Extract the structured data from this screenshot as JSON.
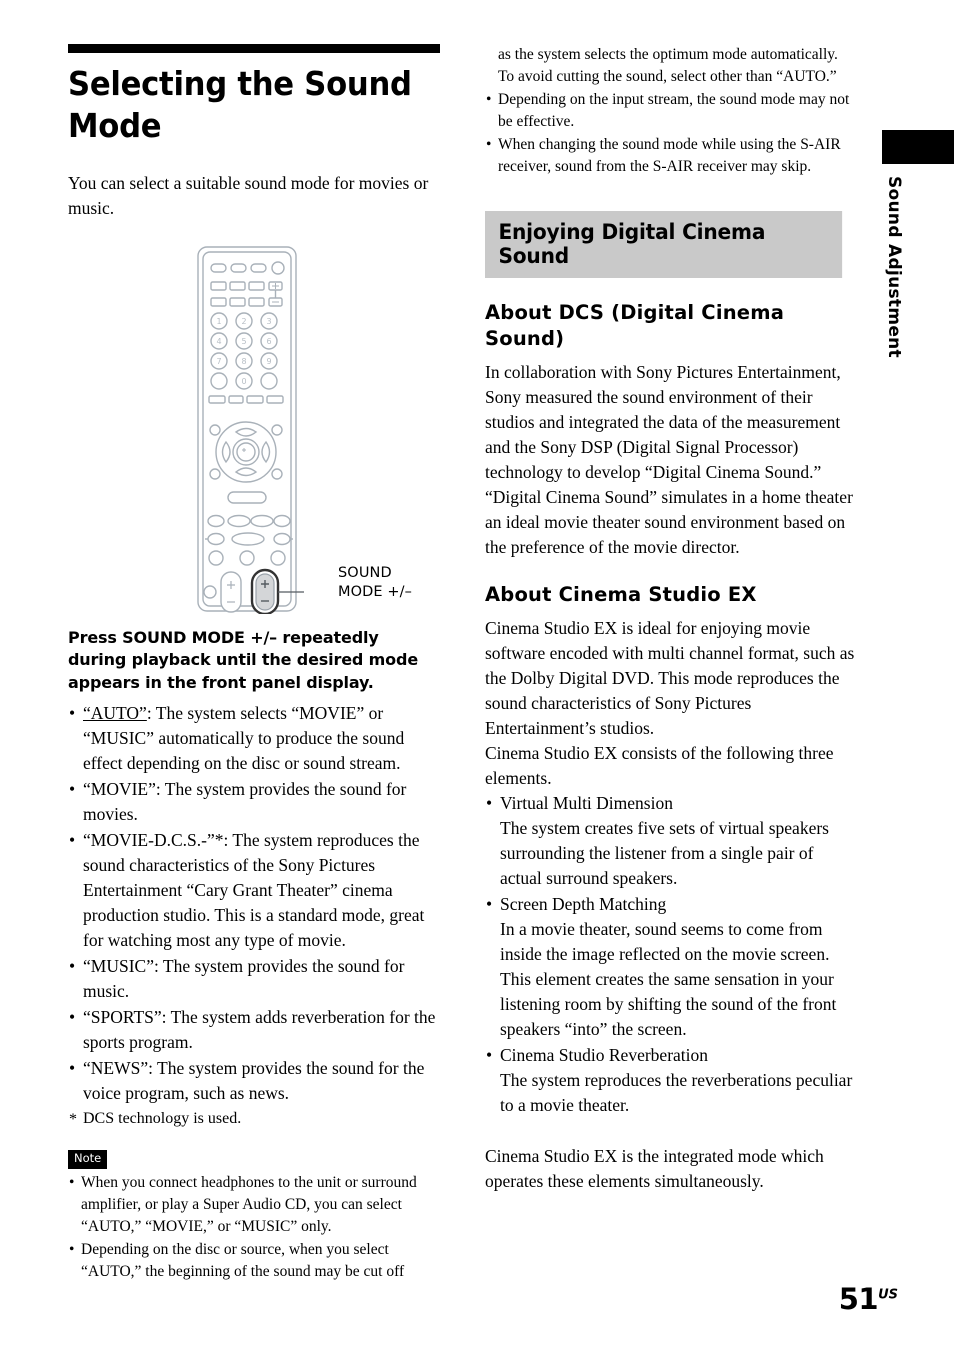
{
  "document": {
    "page_number": "51",
    "page_number_suffix": "US",
    "side_tab_label": "Sound Adjustment"
  },
  "left_column": {
    "title": "Selecting the Sound Mode",
    "intro": "You can select a suitable sound mode for movies or music.",
    "remote_callout": "SOUND MODE +/–",
    "step_heading": "Press SOUND MODE +/– repeatedly during playback until the desired mode appears in the front panel display.",
    "mode_bullets": [
      {
        "underlined_term": "“AUTO”",
        "rest": ": The system selects “MOVIE” or “MUSIC” automatically to produce the sound effect depending on the disc or sound stream."
      },
      {
        "underlined_term": "",
        "rest": "“MOVIE”: The system provides the sound for movies."
      },
      {
        "underlined_term": "",
        "rest": "“MOVIE-D.C.S.-”*: The system reproduces the sound characteristics of the Sony Pictures Entertainment “Cary Grant Theater” cinema production studio. This is a standard mode, great for watching most any type of movie."
      },
      {
        "underlined_term": "",
        "rest": "“MUSIC”: The system provides the sound for music."
      },
      {
        "underlined_term": "",
        "rest": "“SPORTS”: The system adds reverberation for the sports program."
      },
      {
        "underlined_term": "",
        "rest": "“NEWS”: The system provides the sound for the voice program, such as news."
      }
    ],
    "footnote": "DCS technology is used.",
    "note_badge": "Note",
    "note_bullets": [
      "When you connect headphones to the unit or surround amplifier, or play a Super Audio CD, you can select “AUTO,” “MOVIE,” or “MUSIC” only.",
      "Depending on the disc or source, when you select “AUTO,” the beginning of the sound may be cut off"
    ]
  },
  "right_column": {
    "continued_text": "as the system selects the optimum mode automatically. To avoid cutting the sound, select other than “AUTO.”",
    "continued_bullets": [
      "Depending on the input stream, the sound mode may not be effective.",
      "When changing the sound mode while using the S-AIR receiver, sound from the S-AIR receiver may skip."
    ],
    "section_banner": "Enjoying Digital Cinema Sound",
    "dcs_heading": "About DCS (Digital Cinema Sound)",
    "dcs_body": "In collaboration with Sony Pictures Entertainment, Sony measured the sound environment of their studios and integrated the data of the measurement and the Sony DSP (Digital Signal Processor) technology to develop “Digital Cinema Sound.” “Digital Cinema Sound” simulates in a home theater an ideal movie theater sound environment based on the preference of the movie director.",
    "ex_heading": "About Cinema Studio EX",
    "ex_body_1": "Cinema Studio EX is ideal for enjoying movie software encoded with multi channel format, such as the Dolby Digital DVD. This mode reproduces the sound characteristics of Sony Pictures Entertainment’s studios.",
    "ex_body_2": "Cinema Studio EX consists of the following three elements.",
    "ex_elements": [
      {
        "name": "Virtual Multi Dimension",
        "description": "The system creates five sets of virtual speakers surrounding the listener from a single pair of actual surround speakers."
      },
      {
        "name": "Screen Depth Matching",
        "description": "In a movie theater, sound seems to come from inside the image reflected on the movie screen. This element creates the same sensation in your listening room by shifting the sound of the front speakers “into” the screen."
      },
      {
        "name": "Cinema Studio Reverberation",
        "description": "The system reproduces the reverberations peculiar to a movie theater."
      }
    ],
    "closing": "Cinema Studio EX is the integrated mode which operates these elements simultaneously."
  },
  "colors": {
    "banner_gray": "#c9c9c9",
    "text_black": "#000000",
    "remote_outline": "#a8b0b8",
    "remote_fill": "#ffffff"
  }
}
